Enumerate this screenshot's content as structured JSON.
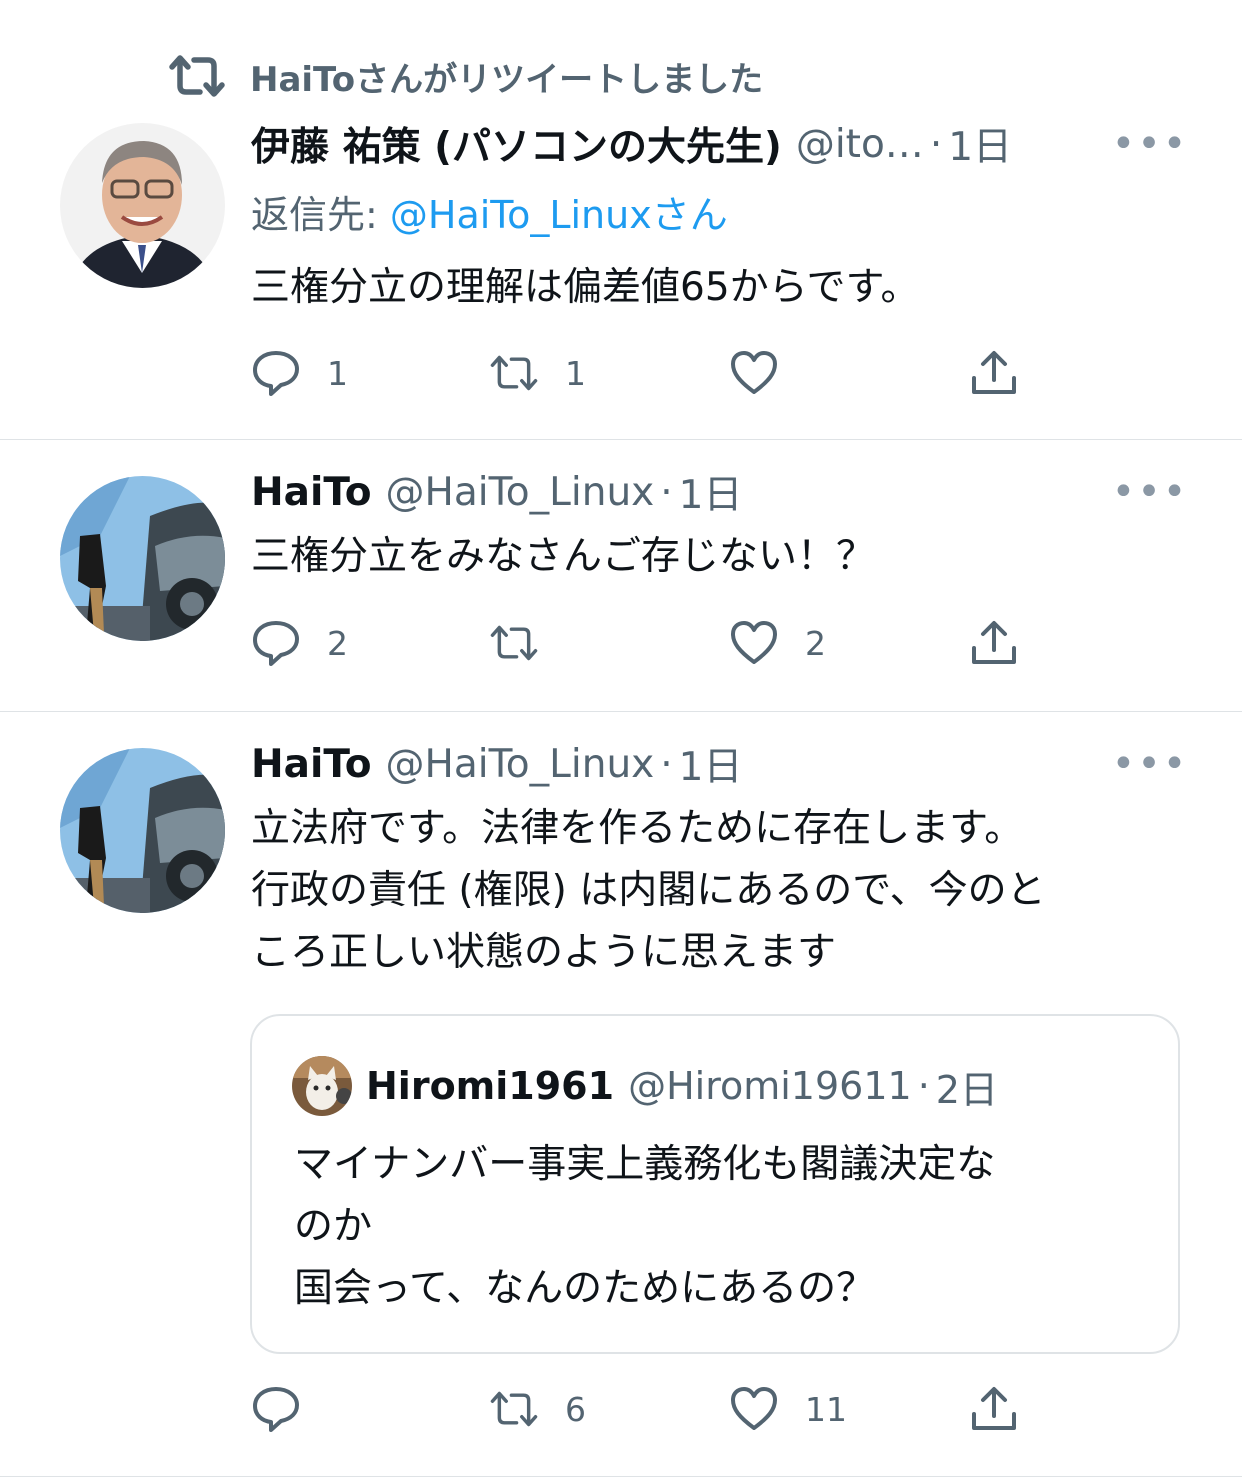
{
  "tweets": [
    {
      "retweet_label": "HaiToさんがリツイートしました",
      "name": "伊藤 祐策 (パソコンの大先生)",
      "handle": "@ito…",
      "time": "1日",
      "reply_prefix": "返信先: ",
      "reply_target": "@HaiTo_Linuxさん",
      "text": "三権分立の理解は偏差値65からです。",
      "reply_count": "1",
      "retweet_count": "1",
      "like_count": ""
    },
    {
      "name": "HaiTo",
      "handle": "@HaiTo_Linux",
      "time": "1日",
      "text": "三権分立をみなさんご存じない！？",
      "reply_count": "2",
      "retweet_count": "",
      "like_count": "2"
    },
    {
      "name": "HaiTo",
      "handle": "@HaiTo_Linux",
      "time": "1日",
      "text_lines": [
        "立法府です。法律を作るために存在します。",
        "行政の責任 (権限) は内閣にあるので、今のと",
        "ころ正しい状態のように思えます"
      ],
      "quote": {
        "name": "Hiromi1961",
        "handle": "@Hiromi19611",
        "time": "2日",
        "text_lines": [
          "マイナンバー事実上義務化も閣議決定な",
          "のか",
          "国会って、なんのためにあるの？"
        ]
      },
      "reply_count": "",
      "retweet_count": "6",
      "like_count": "11"
    }
  ],
  "separator_dot": "·",
  "more_glyph": "•••",
  "icons": {
    "retweet": "retweet-icon",
    "reply": "reply-icon",
    "like": "heart-icon",
    "share": "share-icon",
    "more": "more-options-icon"
  },
  "colors": {
    "text_primary": "#0f1419",
    "text_secondary": "#536471",
    "link": "#1d9bf0",
    "divider": "#dfe3e6"
  }
}
